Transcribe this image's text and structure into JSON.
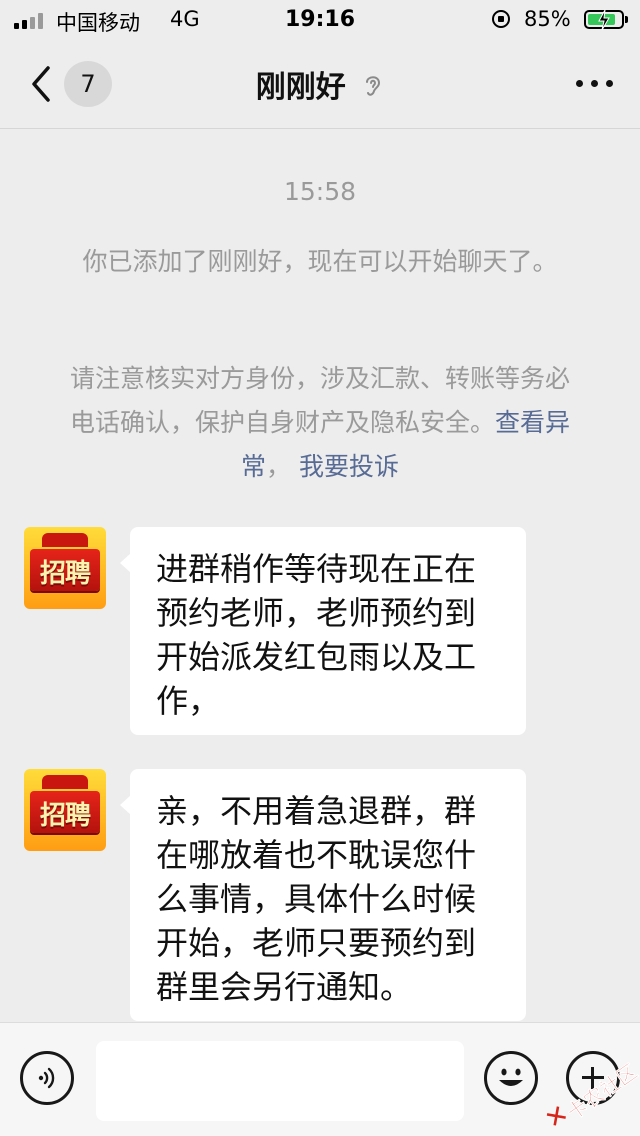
{
  "status_bar": {
    "carrier": "中国移动",
    "network": "4G",
    "time": "19:16",
    "battery_percent": "85%",
    "battery_level": 0.85,
    "battery_color": "#35c759"
  },
  "nav": {
    "unread_count": "7",
    "title": "刚刚好",
    "back_icon": "chevron-left-icon",
    "mute_icon": "ear-icon",
    "more_icon": "more-dots-icon"
  },
  "chat": {
    "timestamp": "15:58",
    "system_added": "你已添加了刚刚好，现在可以开始聊天了。",
    "system_warning": "请注意核实对方身份，涉及汇款、转账等务必电话确认，保护自身财产及隐私安全。",
    "system_links": [
      "查看异常",
      "我要投诉"
    ],
    "link_separator": "，",
    "link_color": "#576b95",
    "messages": [
      {
        "sender_avatar_text": "招聘",
        "text": "进群稍作等待现在正在预约老师，老师预约到开始派发红包雨以及工作，"
      },
      {
        "sender_avatar_text": "招聘",
        "text": "亲，不用着急退群，群在哪放着也不耽误您什么事情，具体什么时候开始，老师只要预约到群里会另行通知。"
      }
    ]
  },
  "input_bar": {
    "voice_icon": "voice-icon",
    "emoji_icon": "emoji-icon",
    "plus_icon": "plus-icon",
    "input_value": ""
  },
  "watermark": {
    "mark": "✕",
    "text": "卡农社区"
  }
}
